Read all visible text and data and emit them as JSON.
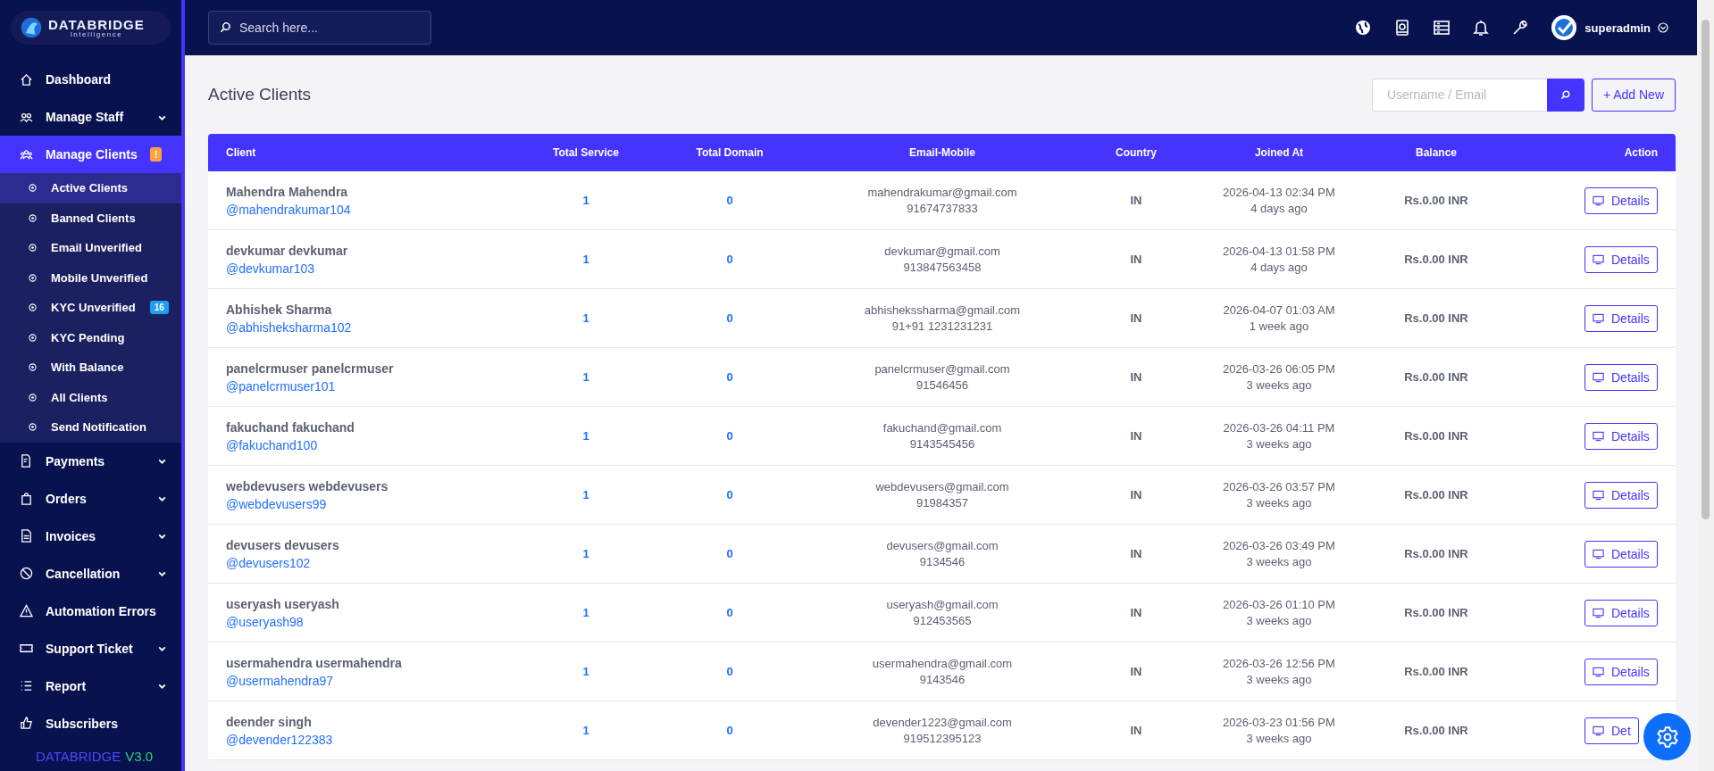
{
  "brand": {
    "name": "DATABRIDGE",
    "tagline": "Intelligence"
  },
  "sidebar": {
    "items": [
      {
        "label": "Dashboard",
        "kind": "link",
        "selected": false
      },
      {
        "label": "Manage Staff",
        "kind": "group",
        "expanded": false,
        "selected": false
      },
      {
        "label": "Manage Clients",
        "kind": "group",
        "expanded": true,
        "selected": true,
        "badge": "!",
        "color": "#ff9f43",
        "children": [
          {
            "label": "Active Clients",
            "selected": true
          },
          {
            "label": "Banned Clients",
            "selected": false
          },
          {
            "label": "Email Unverified",
            "selected": false
          },
          {
            "label": "Mobile Unverified",
            "selected": false
          },
          {
            "label": "KYC Unverified",
            "selected": false,
            "badge": "16",
            "color": "#1e9ff2"
          },
          {
            "label": "KYC Pending",
            "selected": false
          },
          {
            "label": "With Balance",
            "selected": false
          },
          {
            "label": "All Clients",
            "selected": false
          },
          {
            "label": "Send Notification",
            "selected": false
          }
        ]
      },
      {
        "label": "Payments",
        "kind": "group",
        "expanded": false,
        "selected": false
      },
      {
        "label": "Orders",
        "kind": "group",
        "expanded": false,
        "selected": false
      },
      {
        "label": "Invoices",
        "kind": "group",
        "expanded": false,
        "selected": false
      },
      {
        "label": "Cancellation",
        "kind": "group",
        "expanded": false,
        "selected": false
      },
      {
        "label": "Automation Errors",
        "kind": "link",
        "selected": false
      },
      {
        "label": "Support Ticket",
        "kind": "group",
        "expanded": false,
        "selected": false
      },
      {
        "label": "Report",
        "kind": "group",
        "expanded": false,
        "selected": false
      },
      {
        "label": "Subscribers",
        "kind": "link",
        "selected": false
      }
    ],
    "version": {
      "name": "DATABRIDGE",
      "number": "V3.0"
    }
  },
  "topbar": {
    "search": {
      "placeholder": "Search here..."
    },
    "user": "superadmin"
  },
  "page": {
    "title": "Active Clients",
    "filter": {
      "placeholder": "Username / Email"
    },
    "add_button": "+ Add New"
  },
  "table": {
    "columns": [
      "Client",
      "Total Service",
      "Total Domain",
      "Email-Mobile",
      "Country",
      "Joined At",
      "Balance",
      "Action"
    ],
    "rows": [
      {
        "name": "Mahendra Mahendra",
        "username": "@mahendrakumar104",
        "services": "1",
        "domains": "0",
        "email": "mahendrakumar@gmail.com",
        "mobile": "91674737833",
        "country": "IN",
        "joined": "2026-04-13 02:34 PM",
        "ago": "4 days ago",
        "balance": "Rs.0.00 INR",
        "action": "Details"
      },
      {
        "name": "devkumar devkumar",
        "username": "@devkumar103",
        "services": "1",
        "domains": "0",
        "email": "devkumar@gmail.com",
        "mobile": "913847563458",
        "country": "IN",
        "joined": "2026-04-13 01:58 PM",
        "ago": "4 days ago",
        "balance": "Rs.0.00 INR",
        "action": "Details"
      },
      {
        "name": "Abhishek Sharma",
        "username": "@abhisheksharma102",
        "services": "1",
        "domains": "0",
        "email": "abhishekssharma@gmail.com",
        "mobile": "91+91 1231231231",
        "country": "IN",
        "joined": "2026-04-07 01:03 AM",
        "ago": "1 week ago",
        "balance": "Rs.0.00 INR",
        "action": "Details"
      },
      {
        "name": "panelcrmuser panelcrmuser",
        "username": "@panelcrmuser101",
        "services": "1",
        "domains": "0",
        "email": "panelcrmuser@gmail.com",
        "mobile": "91546456",
        "country": "IN",
        "joined": "2026-03-26 06:05 PM",
        "ago": "3 weeks ago",
        "balance": "Rs.0.00 INR",
        "action": "Details"
      },
      {
        "name": "fakuchand fakuchand",
        "username": "@fakuchand100",
        "services": "1",
        "domains": "0",
        "email": "fakuchand@gmail.com",
        "mobile": "9143545456",
        "country": "IN",
        "joined": "2026-03-26 04:11 PM",
        "ago": "3 weeks ago",
        "balance": "Rs.0.00 INR",
        "action": "Details"
      },
      {
        "name": "webdevusers webdevusers",
        "username": "@webdevusers99",
        "services": "1",
        "domains": "0",
        "email": "webdevusers@gmail.com",
        "mobile": "91984357",
        "country": "IN",
        "joined": "2026-03-26 03:57 PM",
        "ago": "3 weeks ago",
        "balance": "Rs.0.00 INR",
        "action": "Details"
      },
      {
        "name": "devusers devusers",
        "username": "@devusers102",
        "services": "1",
        "domains": "0",
        "email": "devusers@gmail.com",
        "mobile": "9134546",
        "country": "IN",
        "joined": "2026-03-26 03:49 PM",
        "ago": "3 weeks ago",
        "balance": "Rs.0.00 INR",
        "action": "Details"
      },
      {
        "name": "useryash useryash",
        "username": "@useryash98",
        "services": "1",
        "domains": "0",
        "email": "useryash@gmail.com",
        "mobile": "912453565",
        "country": "IN",
        "joined": "2026-03-26 01:10 PM",
        "ago": "3 weeks ago",
        "balance": "Rs.0.00 INR",
        "action": "Details"
      },
      {
        "name": "usermahendra usermahendra",
        "username": "@usermahendra97",
        "services": "1",
        "domains": "0",
        "email": "usermahendra@gmail.com",
        "mobile": "9143546",
        "country": "IN",
        "joined": "2026-03-26 12:56 PM",
        "ago": "3 weeks ago",
        "balance": "Rs.0.00 INR",
        "action": "Details"
      },
      {
        "name": "deender singh",
        "username": "@devender122383",
        "services": "1",
        "domains": "0",
        "email": "devender1223@gmail.com",
        "mobile": "919512395123",
        "country": "IN",
        "joined": "2026-03-23 01:56 PM",
        "ago": "3 weeks ago",
        "balance": "Rs.0.00 INR",
        "action": "Det"
      }
    ]
  }
}
